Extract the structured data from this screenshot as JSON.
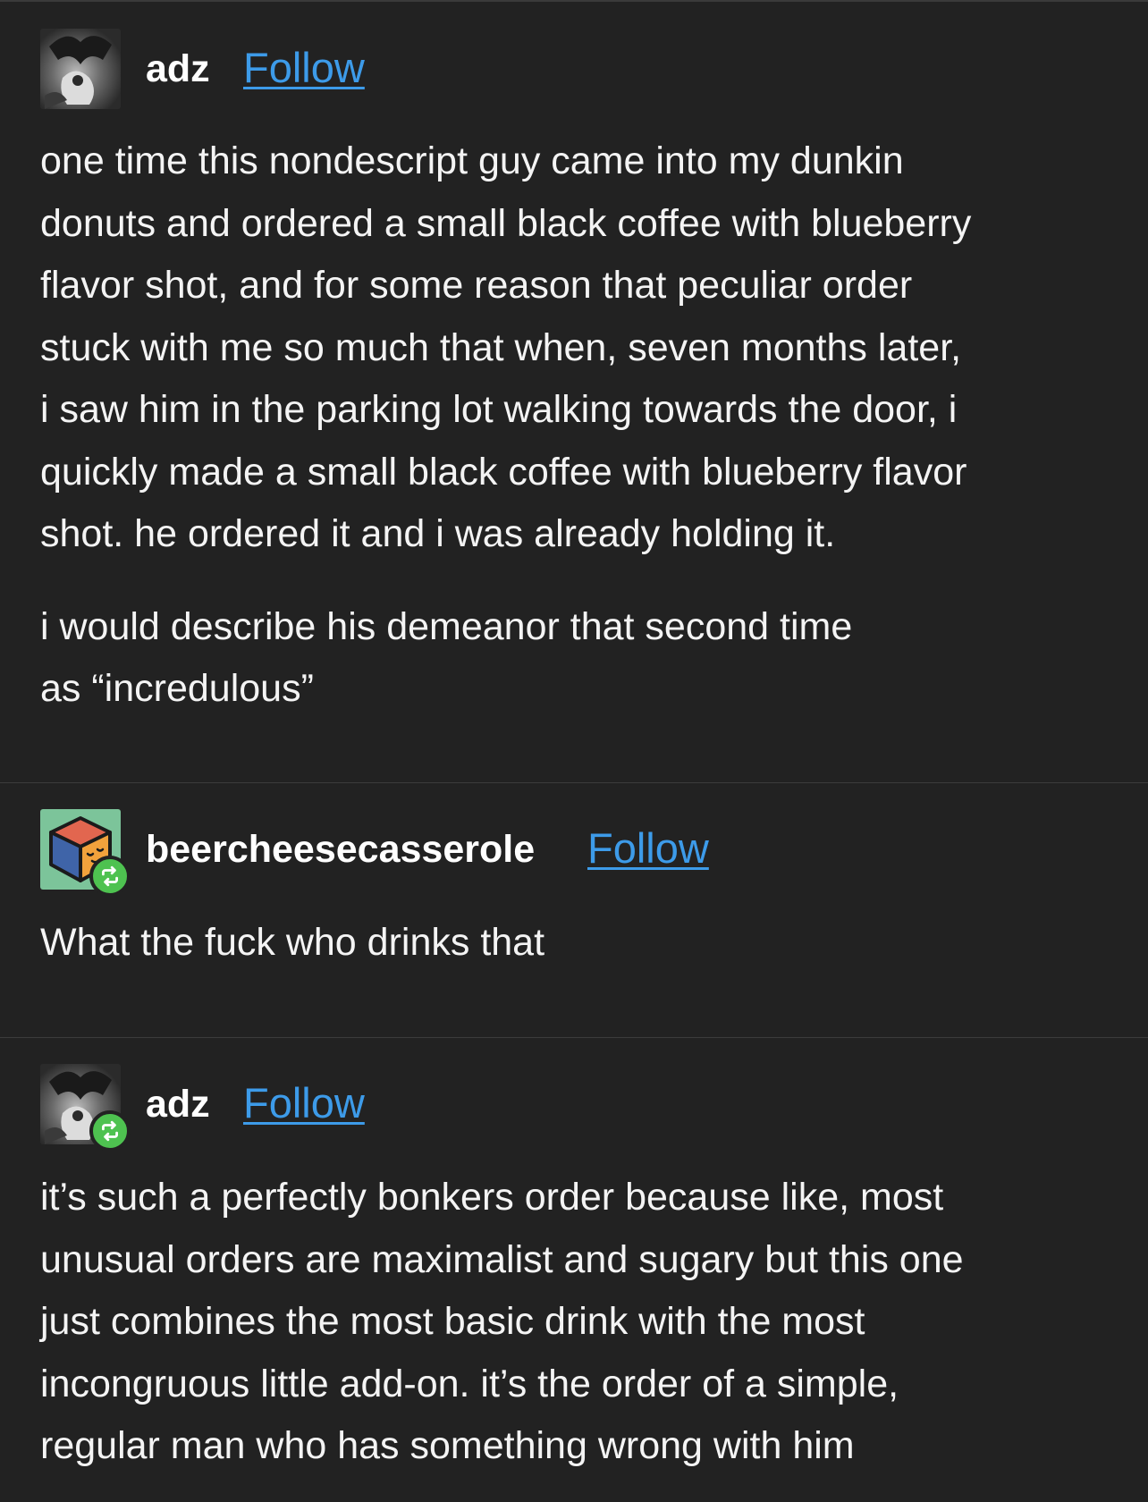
{
  "posts": [
    {
      "username": "adz",
      "follow_label": "Follow",
      "avatar_icon": "dark-illustration-avatar",
      "is_reblog": false,
      "paragraphs": [
        [
          "one time this nondescript guy came into my dunkin",
          "donuts and ordered a small black coffee with blueberry",
          "flavor shot, and for some reason that peculiar order",
          "stuck with me so much that when, seven months later,",
          "i saw him in the parking lot walking towards the door, i",
          "quickly made a small black coffee with blueberry flavor",
          "shot. he ordered it and i was already holding it."
        ],
        [
          "i would describe his demeanor that second time",
          "as “incredulous”"
        ]
      ]
    },
    {
      "username": "beercheesecasserole",
      "follow_label": "Follow",
      "avatar_icon": "sleepy-cube-avatar",
      "is_reblog": true,
      "paragraphs": [
        [
          "What the fuck who drinks that"
        ]
      ]
    },
    {
      "username": "adz",
      "follow_label": "Follow",
      "avatar_icon": "dark-illustration-avatar",
      "is_reblog": true,
      "paragraphs": [
        [
          "it’s such a perfectly bonkers order because like, most",
          "unusual orders are maximalist and sugary but this one",
          "just combines the most basic drink with the most",
          "incongruous little add-on. it’s the order of a simple,",
          "regular man who has something wrong with him"
        ]
      ]
    }
  ],
  "colors": {
    "background": "#222222",
    "text": "#f4f4f4",
    "follow_link": "#3d9be9",
    "reblog_badge": "#4ec250",
    "divider": "#3c3c3c"
  }
}
